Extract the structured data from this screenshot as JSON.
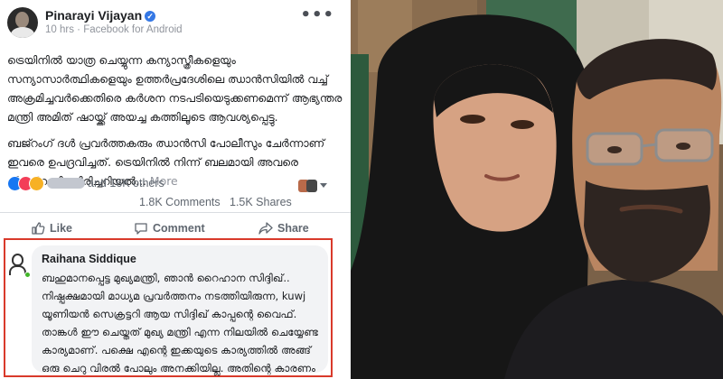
{
  "post": {
    "author": "Pinarayi Vijayan",
    "verified_icon": "verified-badge-icon",
    "time": "10 hrs",
    "separator": "·",
    "source": "Facebook for Android",
    "paragraphs": [
      "ട്രെയിനിൽ യാത്ര ചെയ്യുന്ന കന്യാസ്ത്രീകളെയും സന്യാസാർത്ഥികളെയും ഉത്തർപ്രദേശിലെ ഝാൻസിയിൽ വച്ച് അക്രമിച്ചവർക്കെതിരെ കർശന നടപടിയെടുക്കണമെന്ന് ആഭ്യന്തര മന്ത്രി അമിത് ഷായ്ക്ക് അയച്ച കത്തിലൂടെ ആവശ്യപ്പെട്ടു.",
      "ബജ്റംഗ് ദൾ പ്രവർത്തകരും ഝാൻസി പോലീസും ചേർന്നാണ് ഇവരെ ഉപദ്രവിച്ചത്. ട്രെയിനിൽ നിന്ന് ബലമായി അവരെ പിടിച്ചിറക്കി. തിരിച്ചറിയൽ..."
    ],
    "more_label": "More"
  },
  "reactions": {
    "others_text": "and 16K others",
    "comments": "1.8K Comments",
    "shares": "1.5K Shares"
  },
  "actions": {
    "like": "Like",
    "comment": "Comment",
    "share": "Share"
  },
  "comment": {
    "author": "Raihana Siddique",
    "text": "ബഹുമാനപ്പെട്ട മുഖ്യമന്ത്രി, ഞാൻ റൈഹാന സിദ്ദിഖ്.. നിഷ്പക്ഷമായി മാധ്യമ പ്രവർത്തനം നടത്തിയിരുന്ന, kuwj യൂണിയൻ സെക്രട്ടറി ആയ സിദ്ദിഖ് കാപ്പന്റെ വൈഫ്. താങ്കൾ ഈ ചെയ്തത് മുഖ്യ മന്ത്രി എന്ന നിലയിൽ ചെയ്യേണ്ട കാര്യമാണ്. പക്ഷെ എന്റെ ഇക്കയുടെ കാര്യത്തിൽ അങ്ങ് ഒരു ചെറു വിരൽ പോലും അനക്കിയില്ല. അതിന്റെ കാരണം ഒന്ന് പറഞ്ഞ് തരാമോ.."
  },
  "colors": {
    "highlight_border": "#d93a2b",
    "fb_blue": "#1877f2",
    "muted_text": "#606770"
  }
}
